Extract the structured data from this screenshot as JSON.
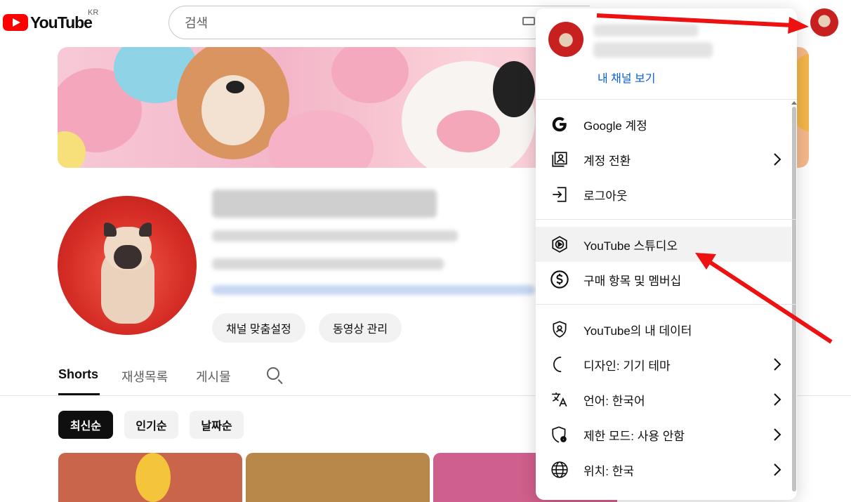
{
  "header": {
    "logo_text": "YouTube",
    "region": "KR",
    "search_placeholder": "검색"
  },
  "channel": {
    "customize_label": "채널 맞춤설정",
    "manage_videos_label": "동영상 관리"
  },
  "tabs": [
    {
      "label": "Shorts",
      "active": true
    },
    {
      "label": "재생목록",
      "active": false
    },
    {
      "label": "게시물",
      "active": false
    }
  ],
  "sort_chips": [
    {
      "label": "최신순",
      "active": true
    },
    {
      "label": "인기순",
      "active": false
    },
    {
      "label": "날짜순",
      "active": false
    }
  ],
  "account_menu": {
    "view_channel": "내 채널 보기",
    "items": [
      {
        "label": "Google 계정",
        "icon": "google-icon",
        "chevron": false
      },
      {
        "label": "계정 전환",
        "icon": "switch-account-icon",
        "chevron": true
      },
      {
        "label": "로그아웃",
        "icon": "sign-out-icon",
        "chevron": false
      },
      {
        "label": "YouTube 스튜디오",
        "icon": "studio-icon",
        "chevron": false,
        "hover": true
      },
      {
        "label": "구매 항목 및 멤버십",
        "icon": "dollar-icon",
        "chevron": false
      },
      {
        "label": "YouTube의 내 데이터",
        "icon": "shield-person-icon",
        "chevron": false
      },
      {
        "label": "디자인: 기기 테마",
        "icon": "moon-icon",
        "chevron": true
      },
      {
        "label": "언어: 한국어",
        "icon": "translate-icon",
        "chevron": true
      },
      {
        "label": "제한 모드: 사용 안함",
        "icon": "restricted-icon",
        "chevron": true
      },
      {
        "label": "위치: 한국",
        "icon": "globe-icon",
        "chevron": true
      }
    ]
  },
  "colors": {
    "brand_red": "#ff0000",
    "link_blue": "#065fd4",
    "annotation_red": "#ee1111"
  }
}
